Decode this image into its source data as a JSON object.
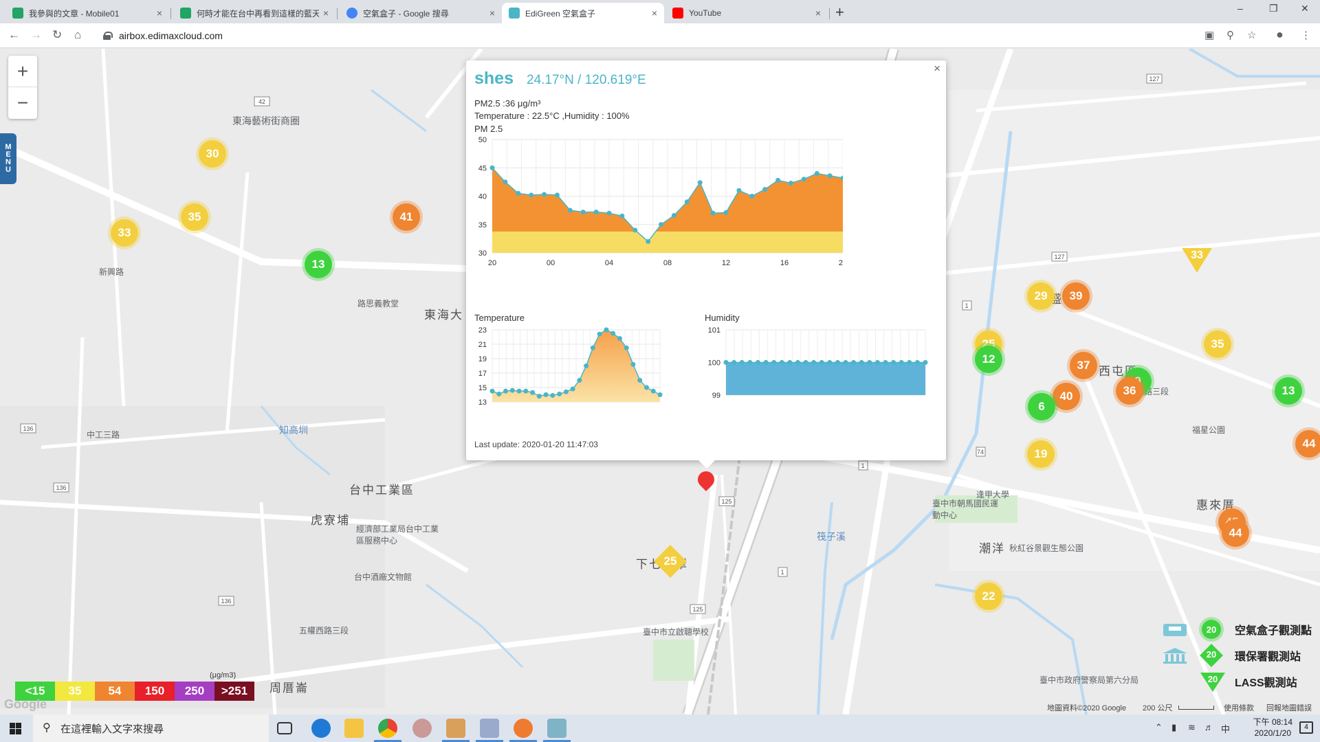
{
  "browser": {
    "tabs": [
      {
        "title": "我參與的文章 - Mobile01",
        "icon_color": "#21a464",
        "active": false
      },
      {
        "title": "何時才能在台中再看到這樣的藍天",
        "icon_color": "#21a464",
        "active": false
      },
      {
        "title": "空氣盒子 - Google 搜尋",
        "icon_color": "#4285f4",
        "active": false
      },
      {
        "title": "EdiGreen 空氣盒子",
        "icon_color": "#4bb5c7",
        "active": true
      },
      {
        "title": "YouTube",
        "icon_color": "#ff0000",
        "active": false
      }
    ],
    "tab_close": "×",
    "new_tab": "+",
    "url": "airbox.edimaxcloud.com",
    "window_controls": [
      "–",
      "❐",
      "✕"
    ]
  },
  "map": {
    "zoom_in": "+",
    "zoom_out": "−",
    "menu_letters": [
      "M",
      "E",
      "N",
      "U"
    ],
    "place_labels": [
      "東海藝術街商圈",
      "東海大",
      "台中工業區",
      "虎寮埔",
      "下七張犁",
      "經濟部工業局台中工業區服務中心",
      "台中酒廠文物館",
      "臺中市立啟聰學校",
      "華盛新村",
      "西屯區",
      "潮洋",
      "惠來厝",
      "周厝崙",
      "新興路",
      "路思義教堂",
      "臺中市朝馬國民運動中心",
      "秋紅谷景觀生態公園",
      "臺中市政府警察局第六分局",
      "福星公園",
      "中工三路",
      "知高圳",
      "筏子溪",
      "西屯路三段",
      "五權西路三段",
      "逢甲大學"
    ],
    "markers": [
      {
        "value": "30",
        "color": "yellow"
      },
      {
        "value": "35",
        "color": "yellow"
      },
      {
        "value": "33",
        "color": "yellow"
      },
      {
        "value": "41",
        "color": "orange"
      },
      {
        "value": "13",
        "color": "green"
      },
      {
        "value": "29",
        "color": "yellow"
      },
      {
        "value": "39",
        "color": "orange"
      },
      {
        "value": "25",
        "color": "yellow"
      },
      {
        "value": "12",
        "color": "green"
      },
      {
        "value": "37",
        "color": "orange"
      },
      {
        "value": "35",
        "color": "yellow"
      },
      {
        "value": "9",
        "color": "green"
      },
      {
        "value": "36",
        "color": "orange"
      },
      {
        "value": "40",
        "color": "orange"
      },
      {
        "value": "6",
        "color": "green"
      },
      {
        "value": "13",
        "color": "green"
      },
      {
        "value": "19",
        "color": "yellow"
      },
      {
        "value": "44",
        "color": "orange"
      },
      {
        "value": "45",
        "color": "orange"
      },
      {
        "value": "44",
        "color": "orange"
      },
      {
        "value": "22",
        "color": "yellow"
      },
      {
        "value": "36",
        "color": "orange"
      }
    ],
    "diamond_marker": "25",
    "triangle_marker": "33",
    "road_shields": [
      "136",
      "136",
      "136",
      "127",
      "127",
      "125",
      "125",
      "1",
      "1",
      "1",
      "74",
      "42"
    ],
    "legend_unit": "(μg/m3)",
    "legend": [
      {
        "label": "<15",
        "color": "#3fd23f"
      },
      {
        "label": "35",
        "color": "#f3e83f"
      },
      {
        "label": "54",
        "color": "#ef8530"
      },
      {
        "label": "150",
        "color": "#e8202a"
      },
      {
        "label": "250",
        "color": "#a53ec2"
      },
      {
        "label": ">251",
        "color": "#7a0f22"
      }
    ],
    "station_types": [
      {
        "label": "空氣盒子觀測點",
        "value": "20"
      },
      {
        "label": "環保署觀測站",
        "value": "20"
      },
      {
        "label": "LASS觀測站",
        "value": "20"
      }
    ],
    "google_mark": "Google",
    "attribution": "地圖資料©2020 Google",
    "scale": "200 公尺",
    "terms": "使用條款",
    "report": "回報地圖錯誤"
  },
  "popup": {
    "name": "shes",
    "coords": "24.17°N / 120.619°E",
    "close": "×",
    "pm25_line": "PM2.5 :36 μg/m³",
    "temp_line": "Temperature : 22.5°C ,Humidity : 100%",
    "last_update": "Last update: 2020-01-20 11:47:03"
  },
  "chart_data": [
    {
      "type": "area",
      "title": "PM 2.5",
      "x_ticks": [
        "20",
        "00",
        "04",
        "08",
        "12",
        "16",
        "20"
      ],
      "ylim": [
        30,
        50
      ],
      "y_ticks": [
        30,
        35,
        40,
        45,
        50
      ],
      "values": [
        45,
        42.5,
        40.5,
        40.2,
        40.3,
        40.2,
        37.5,
        37.2,
        37.2,
        37,
        36.5,
        34,
        32,
        35,
        36.6,
        39,
        42.4,
        37,
        37.1,
        41,
        40,
        41.2,
        42.8,
        42.3,
        43,
        44,
        43.6,
        43.2
      ],
      "grid": true,
      "colors": {
        "upper": "#f39233",
        "lower": "#f7dc63"
      }
    },
    {
      "type": "area",
      "title": "Temperature",
      "ylim": [
        13,
        23
      ],
      "y_ticks": [
        13,
        15,
        17,
        19,
        21,
        23
      ],
      "values": [
        14.5,
        14.1,
        14.5,
        14.6,
        14.5,
        14.5,
        14.3,
        13.8,
        14,
        13.9,
        14.1,
        14.4,
        14.8,
        16,
        18,
        20.5,
        22.4,
        23,
        22.5,
        21.8,
        20.5,
        18.2,
        16,
        15,
        14.5,
        14
      ],
      "grid": true,
      "color": "#f7c26b"
    },
    {
      "type": "area",
      "title": "Humidity",
      "ylim": [
        99,
        101
      ],
      "y_ticks": [
        99,
        100,
        101
      ],
      "values": [
        100,
        100,
        100,
        100,
        100,
        100,
        100,
        100,
        100,
        100,
        100,
        100,
        100,
        100,
        100,
        100,
        100,
        100,
        100,
        100,
        100,
        100,
        100,
        100,
        100,
        100
      ],
      "grid": true,
      "color": "#5fb3d8"
    }
  ],
  "taskbar": {
    "search_placeholder": "在這裡輸入文字來搜尋",
    "time": "下午 08:14",
    "date": "2020/1/20",
    "ime": "中",
    "notif_count": "4"
  }
}
